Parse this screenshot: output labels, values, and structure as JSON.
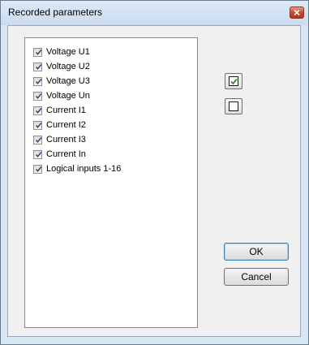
{
  "window": {
    "title": "Recorded parameters"
  },
  "list": {
    "items": [
      {
        "label": "Voltage U1",
        "checked": true
      },
      {
        "label": "Voltage U2",
        "checked": true
      },
      {
        "label": "Voltage U3",
        "checked": true
      },
      {
        "label": "Voltage Un",
        "checked": true
      },
      {
        "label": "Current I1",
        "checked": true
      },
      {
        "label": "Current I2",
        "checked": true
      },
      {
        "label": "Current I3",
        "checked": true
      },
      {
        "label": "Current In",
        "checked": true
      },
      {
        "label": "Logical inputs 1-16",
        "checked": true
      }
    ]
  },
  "buttons": {
    "ok_label": "OK",
    "cancel_label": "Cancel"
  },
  "icons": {
    "check_all": "check-all-icon",
    "uncheck_all": "uncheck-all-icon",
    "close": "close-icon"
  },
  "colors": {
    "check_green": "#2e8b2e",
    "check_blue": "#2b4f8e",
    "close_red": "#c84a30"
  }
}
